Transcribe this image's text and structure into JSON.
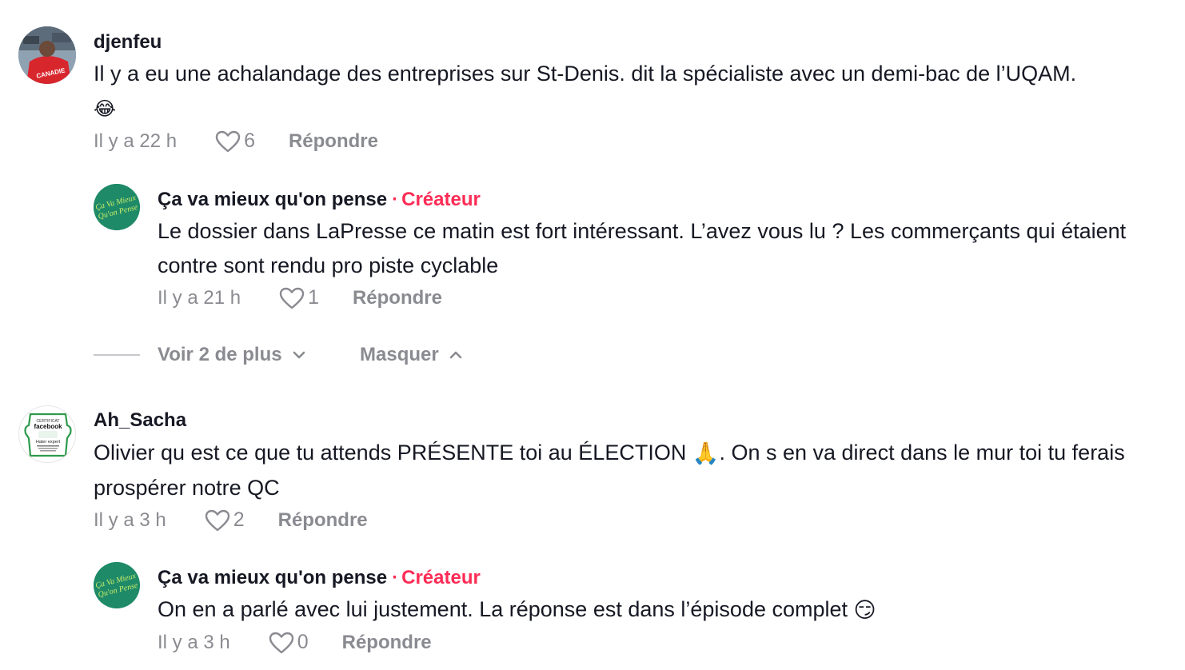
{
  "comments": [
    {
      "username": "djenfeu",
      "text": "Il y a eu une achalandage des entreprises sur St-Denis. dit la spécialiste avec un demi-bac de l’UQAM.",
      "emoji": "😂",
      "time": "Il y a 22 h",
      "likes": "6",
      "reply_label": "Répondre",
      "avatar_jersey_text": "CANADIE",
      "replies": [
        {
          "username": "Ça va mieux qu'on pense",
          "separator": "·",
          "badge": "Créateur",
          "text": "Le dossier dans LaPresse ce matin est fort intéressant. L’avez vous lu ? Les commerçants qui étaient contre sont rendu pro piste cyclable",
          "time": "Il y a 21 h",
          "likes": "1",
          "reply_label": "Répondre",
          "avatar_text": "Ça Va Mieux Qu'on Pense"
        }
      ],
      "thread_controls": {
        "view_more": "Voir 2 de plus",
        "hide": "Masquer"
      }
    },
    {
      "username": "Ah_Sacha",
      "text_before_emoji": "Olivier qu est ce que tu attends PRÉSENTE toi au ÉLECTION",
      "emoji": "🙏",
      "text_after_emoji": ". On s en va direct dans le mur toi tu ferais prospérer notre QC",
      "time": "Il y a 3 h",
      "likes": "2",
      "reply_label": "Répondre",
      "avatar_badge": {
        "top": "CERTIFICAT",
        "brand": "facebook",
        "title": "Hater expert"
      },
      "replies": [
        {
          "username": "Ça va mieux qu'on pense",
          "separator": "·",
          "badge": "Créateur",
          "text": "On en a parlé avec lui justement. La réponse est dans l’épisode complet",
          "emoji": "😏",
          "time": "Il y a 3 h",
          "likes": "0",
          "reply_label": "Répondre",
          "avatar_text": "Ça Va Mieux Qu'on Pense"
        }
      ]
    }
  ],
  "colors": {
    "creator_badge": "#fe2c55",
    "meta_gray": "#8a8b91",
    "brand_green": "#1f8a68",
    "brand_text": "#c8ee6a"
  }
}
